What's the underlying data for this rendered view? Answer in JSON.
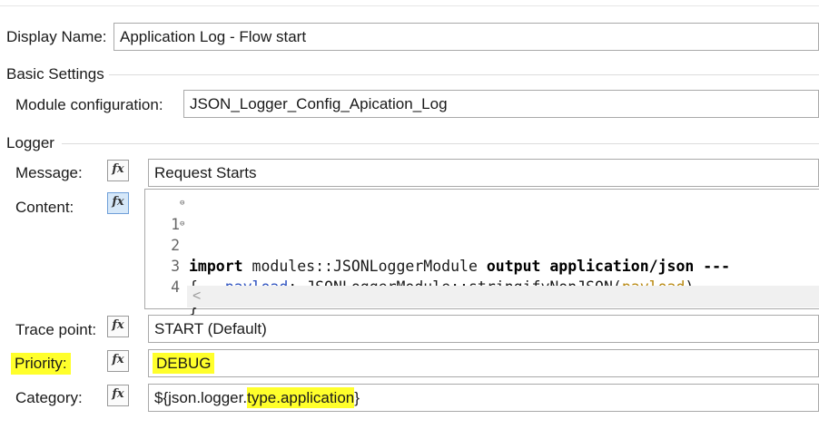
{
  "display_name": {
    "label": "Display Name:",
    "value": "Application Log - Flow start"
  },
  "basic_settings": {
    "title": "Basic Settings",
    "module_config_label": "Module configuration:",
    "module_config_value": "JSON_Logger_Config_Apication_Log"
  },
  "logger": {
    "title": "Logger",
    "fx_icon": "fx",
    "message": {
      "label": "Message:",
      "value": "Request Starts"
    },
    "content": {
      "label": "Content:",
      "lines": [
        {
          "num": "1",
          "fold": "⊖",
          "kw1": "import",
          "mid": " modules::JSONLoggerModule ",
          "kw2": "output application/json ---"
        },
        {
          "num": "2",
          "fold": "⊖",
          "text": "{"
        },
        {
          "num": "3",
          "indent": "    ",
          "prop": "payload",
          "mid": ": JSONLoggerModule::stringifyNonJSON(",
          "var": "payload",
          "end": ")"
        },
        {
          "num": "4",
          "text": "}"
        }
      ],
      "scroll_left_icon": "<"
    },
    "trace_point": {
      "label": "Trace point:",
      "value": "START (Default)"
    },
    "priority": {
      "label": "Priority:",
      "value": "DEBUG"
    },
    "category": {
      "label": "Category:",
      "value_prefix": "${json.logger.",
      "value_highlight": "type.application",
      "value_suffix": "}"
    }
  },
  "colors": {
    "highlight": "#ffff2b",
    "fx_active": "#d6e8f9",
    "keyword_prop": "#2a4fbf",
    "keyword_var": "#b7860b"
  }
}
